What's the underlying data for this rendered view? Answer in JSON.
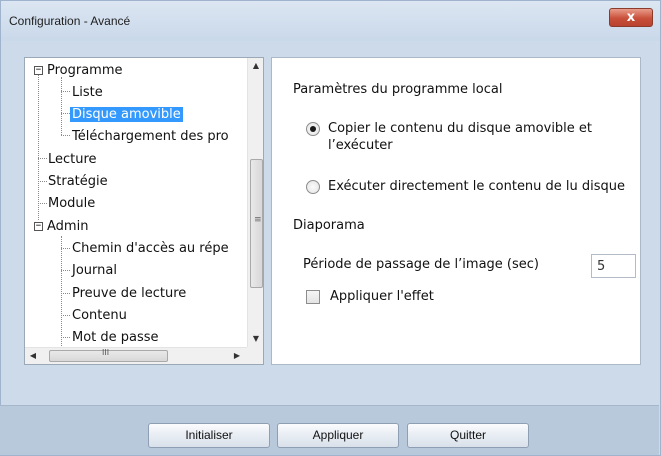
{
  "window": {
    "title": "Configuration - Avancé",
    "close_glyph": "x"
  },
  "tree": {
    "items": [
      {
        "label": "Programme",
        "expander": "−"
      },
      {
        "label": "Liste"
      },
      {
        "label": "Disque amovible",
        "selected": true
      },
      {
        "label": "Téléchargement des pro"
      },
      {
        "label": "Lecture"
      },
      {
        "label": "Stratégie"
      },
      {
        "label": "Module"
      },
      {
        "label": "Admin",
        "expander": "−"
      },
      {
        "label": "Chemin d'accès au répe"
      },
      {
        "label": "Journal"
      },
      {
        "label": "Preuve de lecture"
      },
      {
        "label": "Contenu"
      },
      {
        "label": "Mot de passe"
      }
    ],
    "scroll_up": "▲",
    "scroll_down": "▼",
    "scroll_left": "◀",
    "scroll_right": "▶",
    "vgrip": "≡",
    "hgrip": "III"
  },
  "settings": {
    "local_program_heading": "Paramètres du programme local",
    "option_copy_line1": "Copier le contenu du disque amovible et",
    "option_copy_line2": "l’exécuter",
    "option_execute": "Exécuter directement le contenu de lu disque",
    "selected_option": "copy",
    "slideshow_heading": "Diaporama",
    "image_period_label": "Période de passage de l’image (sec)",
    "image_period_value": "5",
    "apply_effect_label": "Appliquer l'effet",
    "apply_effect_checked": false
  },
  "buttons": {
    "reset": "Initialiser",
    "apply": "Appliquer",
    "quit": "Quitter"
  },
  "colors": {
    "selection": "#3399ff",
    "window_background": "#ccdaea",
    "close_button": "#c9503a"
  }
}
